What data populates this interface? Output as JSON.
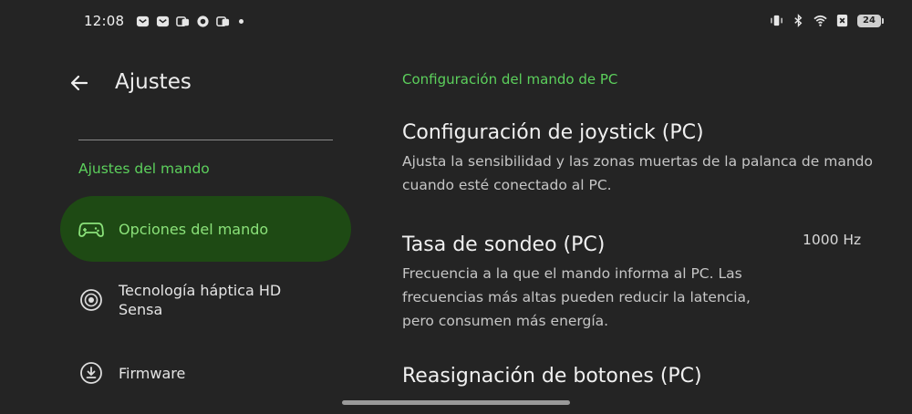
{
  "status_bar": {
    "time": "12:08",
    "notification_icons": [
      "mail-icon",
      "mail-icon",
      "app-badge-icon",
      "messenger-icon",
      "app-badge-icon"
    ],
    "system_icons": [
      "vibrate-icon",
      "bluetooth-icon",
      "wifi-icon",
      "no-sim-icon"
    ],
    "battery": "24"
  },
  "header": {
    "title": "Ajustes"
  },
  "sidebar": {
    "section_label": "Ajustes del mando",
    "items": [
      {
        "label": "Opciones del mando",
        "icon": "gamepad-icon",
        "active": true
      },
      {
        "label": "Tecnología háptica HD Sensa",
        "icon": "haptic-icon",
        "active": false
      },
      {
        "label": "Firmware",
        "icon": "download-icon",
        "active": false
      }
    ]
  },
  "main": {
    "section_label": "Configuración del mando de PC",
    "settings": [
      {
        "title": "Configuración de joystick (PC)",
        "description": "Ajusta la sensibilidad y las zonas muertas de la palanca de mando cuando esté conectado al PC."
      },
      {
        "title": "Tasa de sondeo (PC)",
        "description": "Frecuencia a la que el mando informa al PC. Las frecuencias más altas pueden reducir la latencia, pero consumen más energía.",
        "value": "1000 Hz"
      },
      {
        "title": "Reasignación de botones (PC)"
      }
    ]
  },
  "colors": {
    "background": "#242424",
    "accent_green": "#5cd05c",
    "active_pill": "#1e4a14",
    "active_text": "#8be27a"
  }
}
